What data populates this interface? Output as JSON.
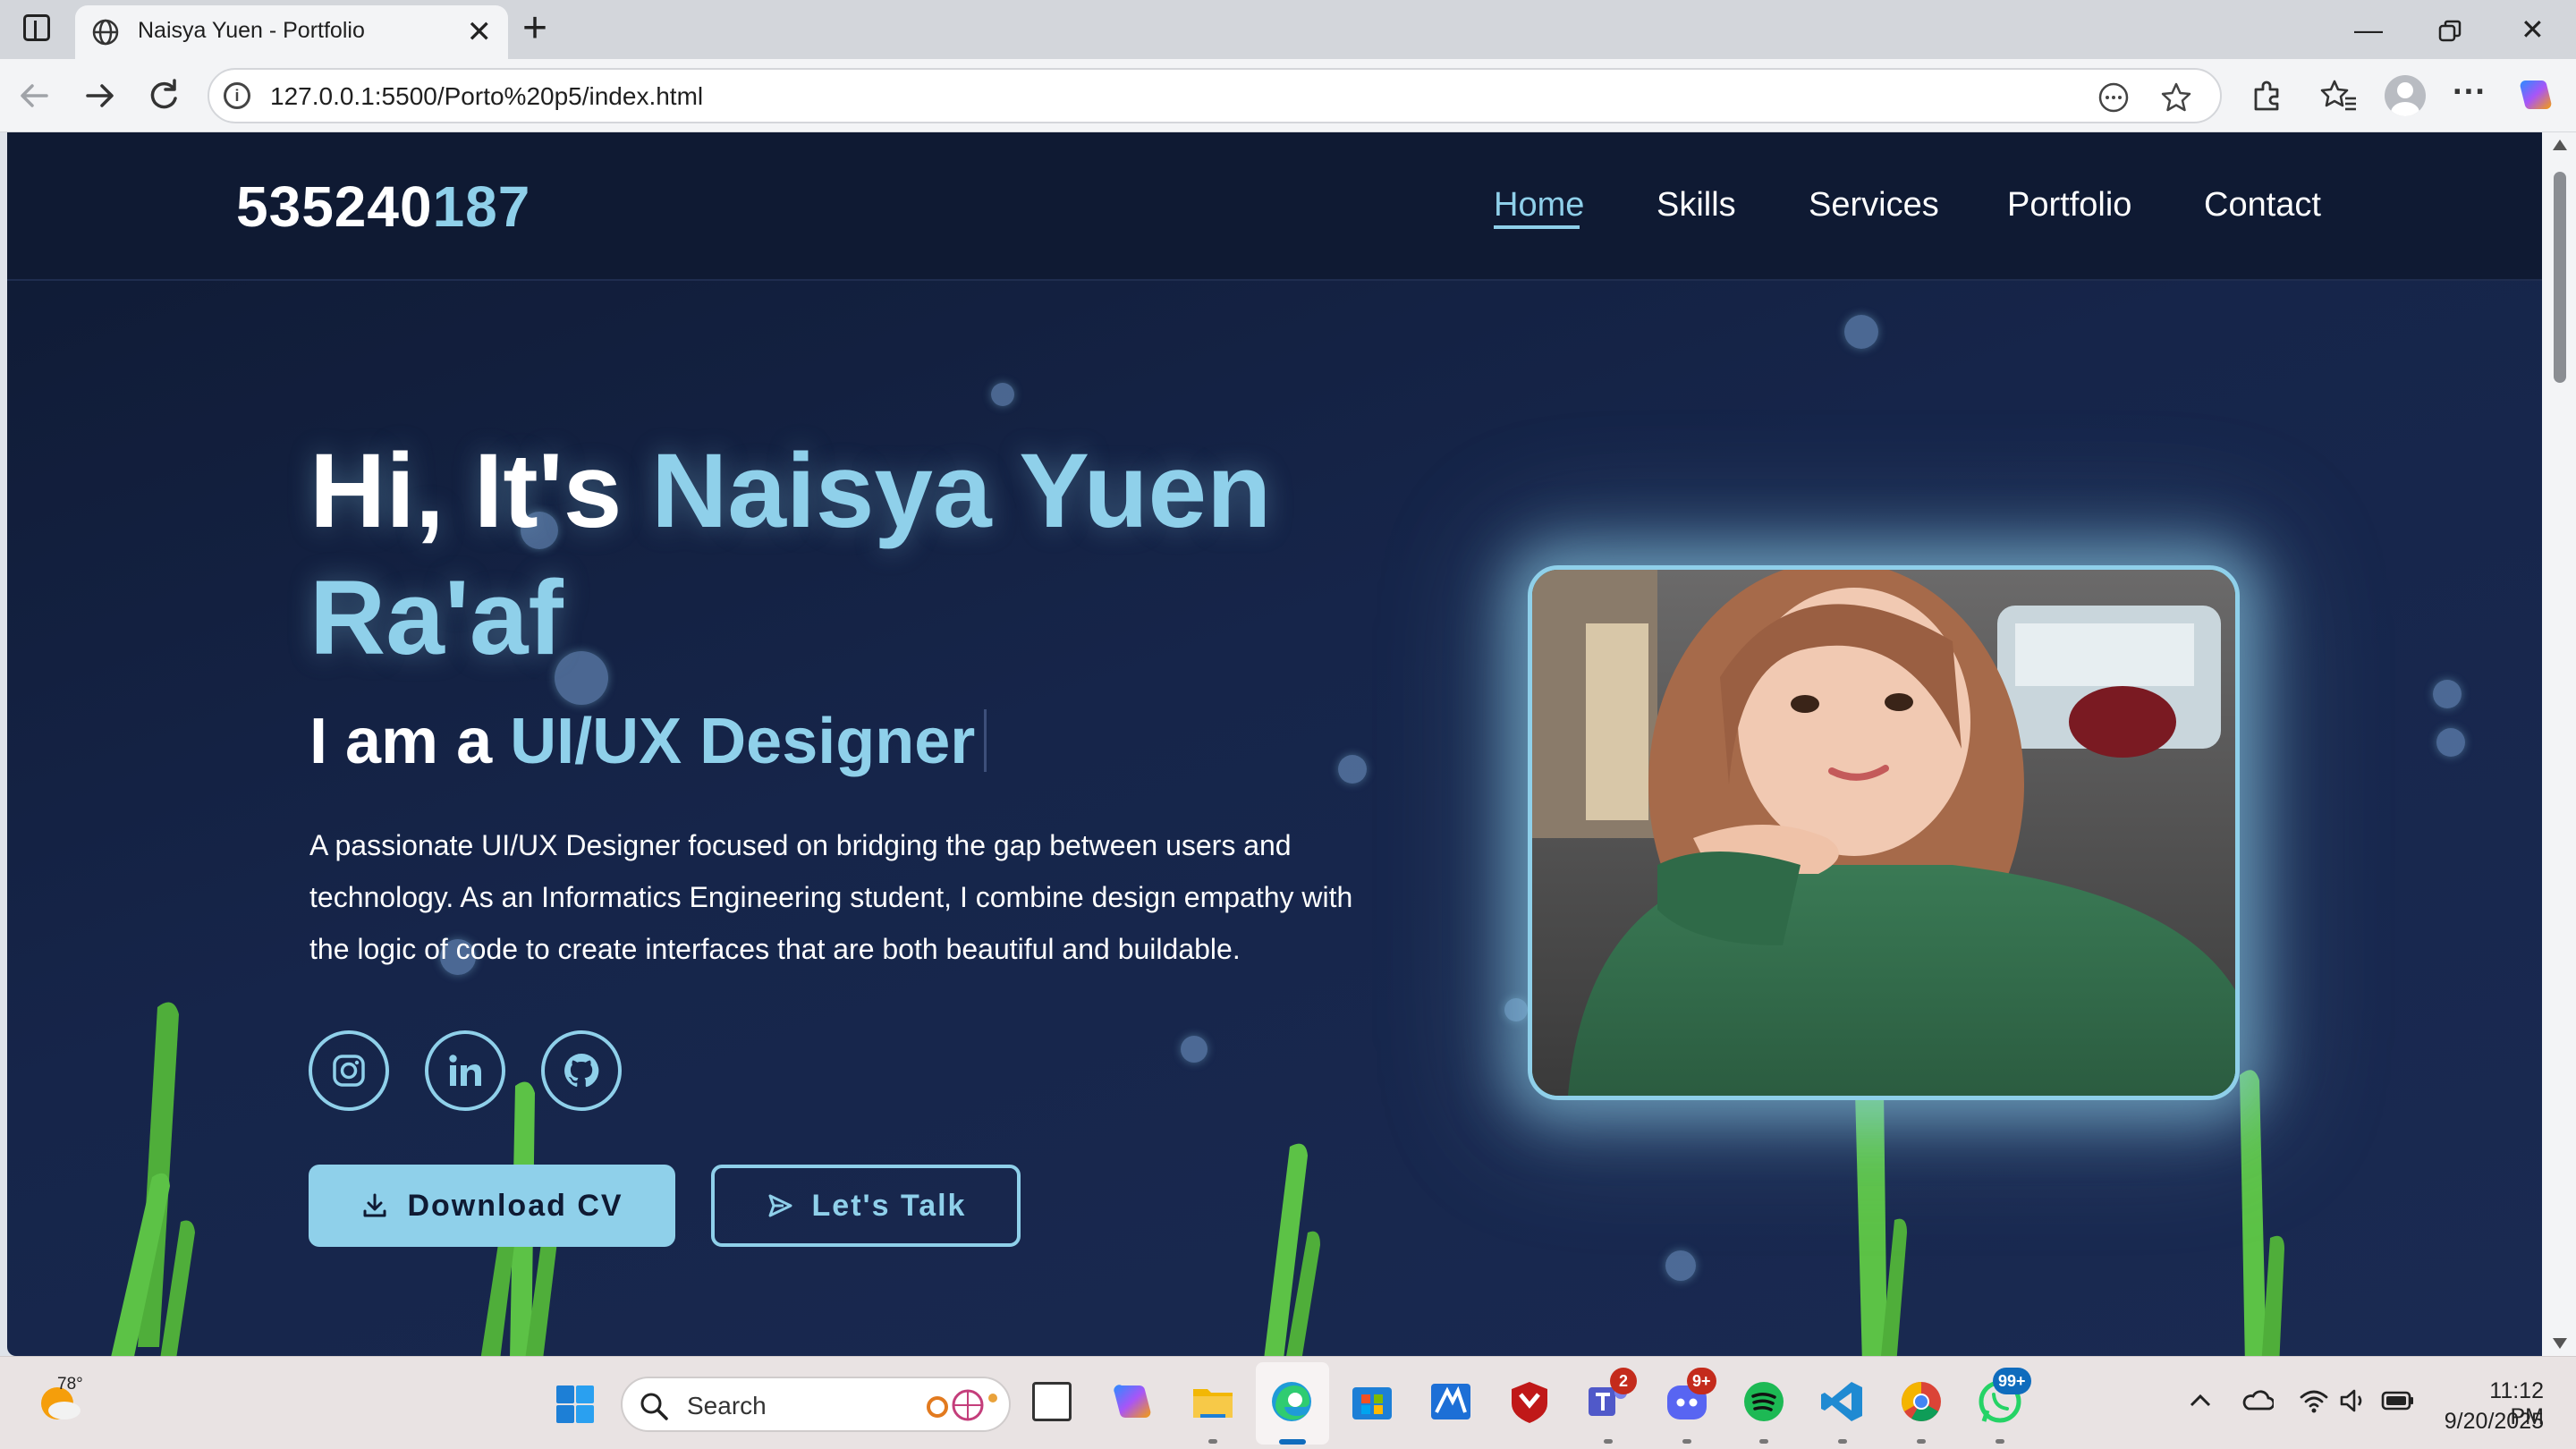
{
  "browser": {
    "tab_title": "Naisya Yuen - Portfolio",
    "url": "127.0.0.1:5500/Porto%20p5/index.html"
  },
  "site": {
    "logo_main": "535240",
    "logo_accent": "187",
    "nav": [
      {
        "label": "Home",
        "active": true
      },
      {
        "label": "Skills",
        "active": false
      },
      {
        "label": "Services",
        "active": false
      },
      {
        "label": "Portfolio",
        "active": false
      },
      {
        "label": "Contact",
        "active": false
      }
    ]
  },
  "hero": {
    "greeting": "Hi, It's ",
    "name_line1": "Naisya Yuen",
    "name_line2": "Ra'af",
    "role_prefix": "I am a ",
    "role": "UI/UX Designer",
    "description": "A passionate UI/UX Designer focused on bridging the gap between users and technology. As an Informatics Engineering student, I combine design empathy with the logic of code to create interfaces that are both beautiful and buildable.",
    "socials": [
      "instagram-icon",
      "linkedin-icon",
      "github-icon"
    ],
    "primary_button": "Download CV",
    "secondary_button": "Let's Talk",
    "accent_color": "#8fd0ea",
    "background_color": "#0f1a33"
  },
  "taskbar": {
    "weather_temp": "78°",
    "search_placeholder": "Search",
    "badges": {
      "teams": "2",
      "discord": "9+",
      "whatsapp": "99+"
    },
    "time": "11:12 PM",
    "date": "9/20/2025"
  }
}
